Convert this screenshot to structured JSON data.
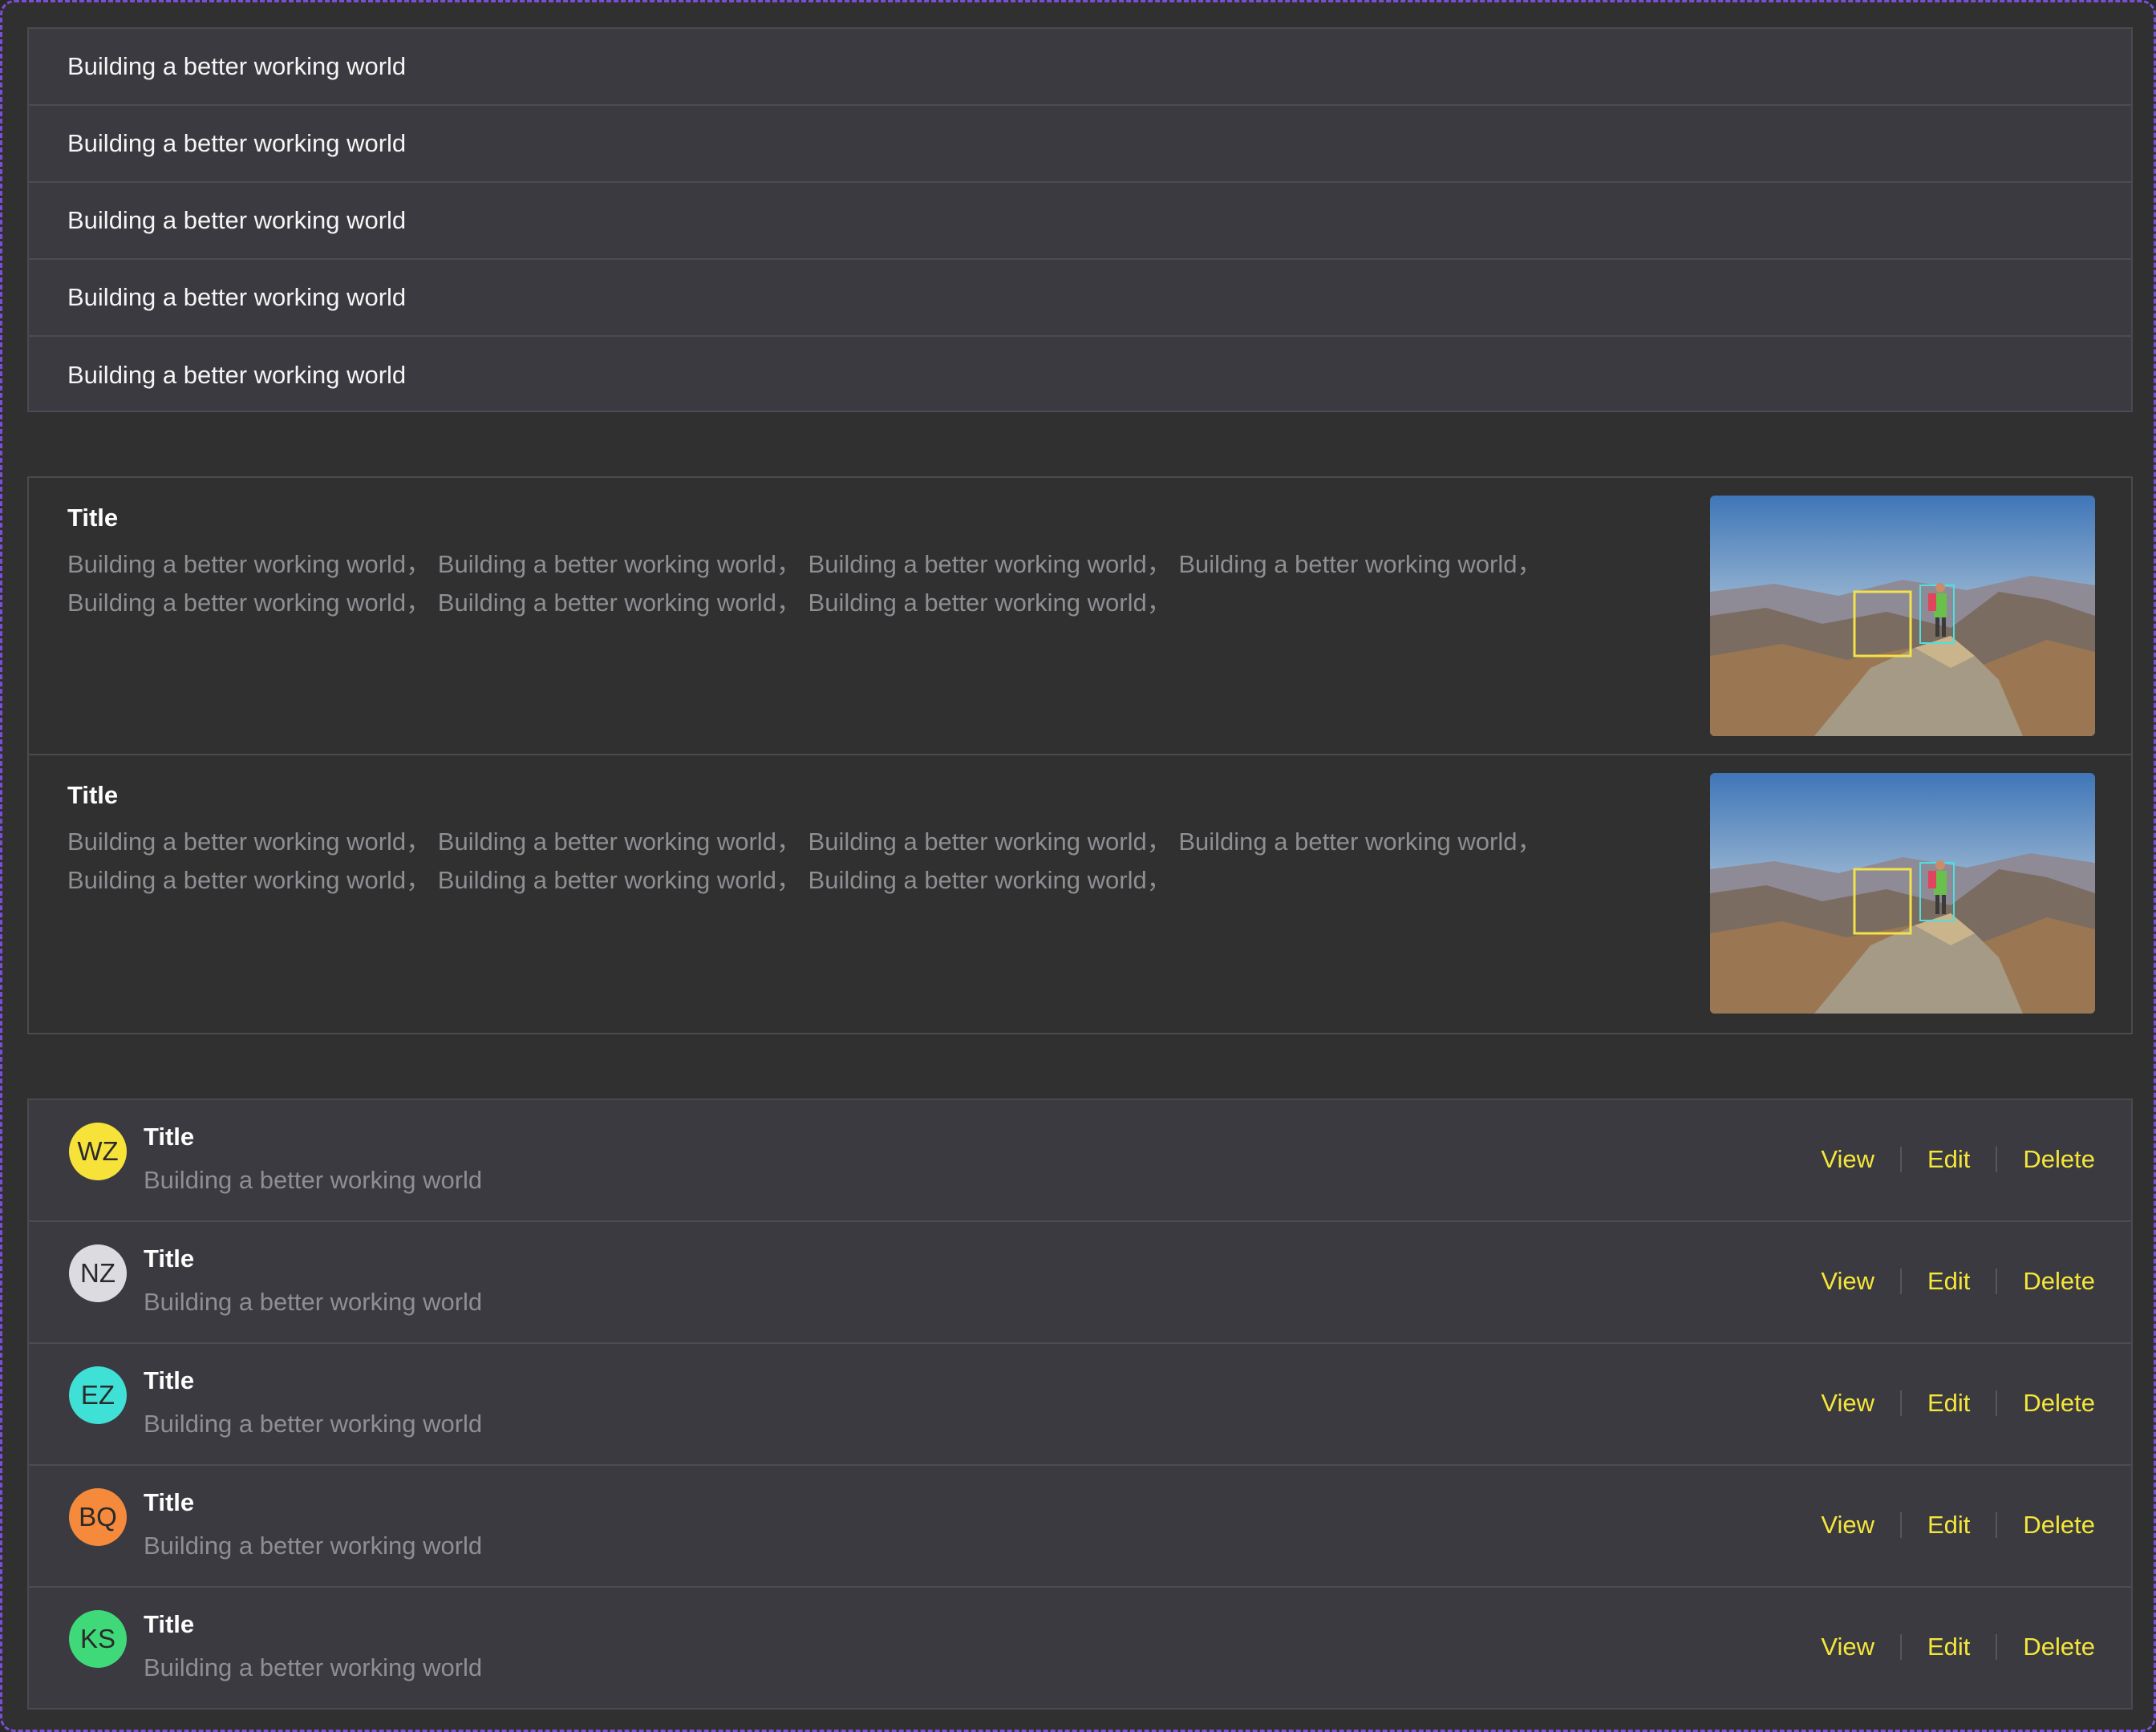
{
  "simple_list": {
    "items": [
      "Building a better working world",
      "Building a better working world",
      "Building a better working world",
      "Building a better working world",
      "Building a better working world"
    ]
  },
  "article_list": {
    "items": [
      {
        "title": "Title",
        "line1": "Building a better working world， Building a better working world， Building a better working world， Building a better working world，",
        "line2": "Building a better working world， Building a better working world， Building a better working world，",
        "image_icon": "mountain-hiker-photo"
      },
      {
        "title": "Title",
        "line1": "Building a better working world， Building a better working world， Building a better working world， Building a better working world，",
        "line2": "Building a better working world， Building a better working world， Building a better working world，",
        "image_icon": "mountain-hiker-photo"
      }
    ]
  },
  "action_list": {
    "actions": {
      "view": "View",
      "edit": "Edit",
      "delete": "Delete"
    },
    "action_color": "#f5e63a",
    "items": [
      {
        "initials": "WZ",
        "avatar_color": "#f7e23a",
        "title": "Title",
        "desc": "Building a better working world"
      },
      {
        "initials": "NZ",
        "avatar_color": "#dcdce0",
        "title": "Title",
        "desc": "Building a better working world"
      },
      {
        "initials": "EZ",
        "avatar_color": "#3fe0d6",
        "title": "Title",
        "desc": "Building a better working world"
      },
      {
        "initials": "BQ",
        "avatar_color": "#f58a3c",
        "title": "Title",
        "desc": "Building a better working world"
      },
      {
        "initials": "KS",
        "avatar_color": "#3fd97a",
        "title": "Title",
        "desc": "Building a better working world"
      }
    ]
  }
}
